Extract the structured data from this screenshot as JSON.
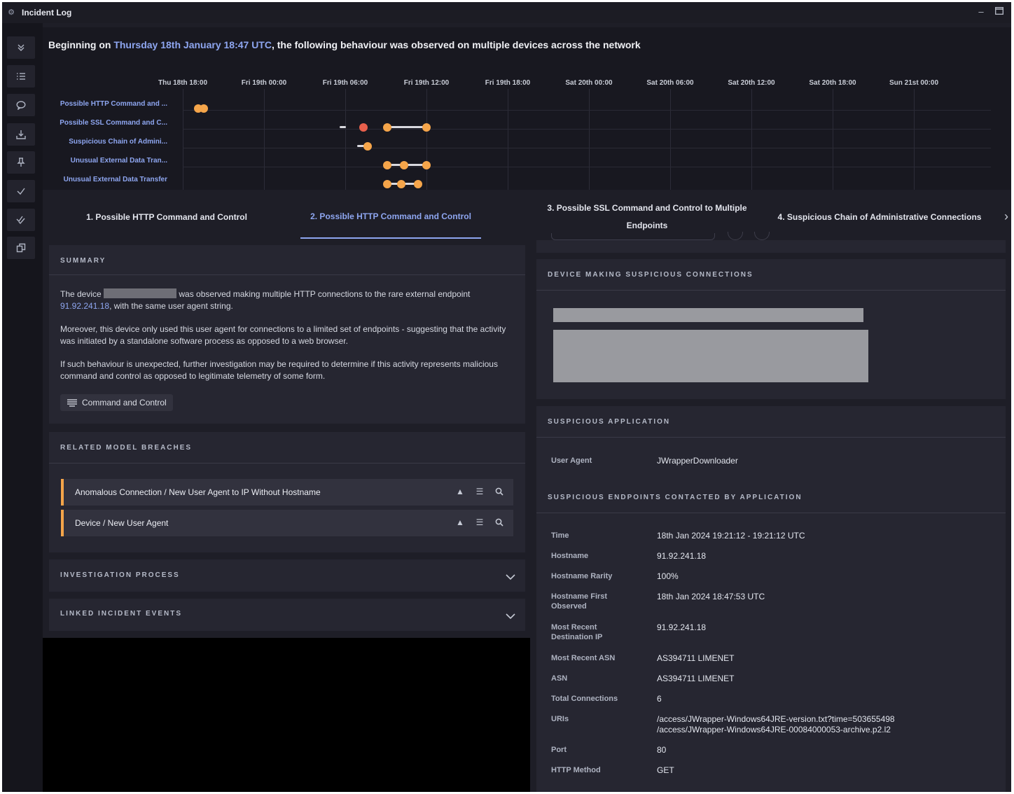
{
  "window": {
    "title": "Incident Log",
    "app_icon": "gear-cluster-icon",
    "minimize_icon": "minimize-icon",
    "maximize_icon": "maximize-icon"
  },
  "sidebar": {
    "items": [
      {
        "icon": "chevron-double-down-icon"
      },
      {
        "icon": "list-icon"
      },
      {
        "icon": "comment-icon"
      },
      {
        "icon": "download-icon"
      },
      {
        "icon": "pin-icon"
      },
      {
        "icon": "check-icon"
      },
      {
        "icon": "double-check-icon"
      },
      {
        "icon": "copy-icon"
      }
    ]
  },
  "headline": {
    "prefix": "Beginning on ",
    "date": "Thursday 18th January 18:47 UTC",
    "suffix": ", the following behaviour was observed on multiple devices across the network"
  },
  "timeline": {
    "ticks": [
      "Thu 18th 18:00",
      "Fri 19th 00:00",
      "Fri 19th 06:00",
      "Fri 19th 12:00",
      "Fri 19th 18:00",
      "Sat 20th 00:00",
      "Sat 20th 06:00",
      "Sat 20th 12:00",
      "Sat 20th 18:00",
      "Sun 21st 00:00"
    ],
    "rows": [
      "Possible HTTP Command and ...",
      "Possible SSL Command and C...",
      "Suspicious Chain of Admini...",
      "Unusual External Data Tran...",
      "Unusual External Data Transfer"
    ],
    "colors": {
      "event": "#f5a54a",
      "selected": "#e8604c",
      "bar": "#d9d9df"
    }
  },
  "tabs": [
    {
      "label": "1. Possible HTTP Command and Control",
      "active": false
    },
    {
      "label": "2. Possible HTTP Command and Control",
      "active": true
    },
    {
      "label_line1": "3. Possible SSL Command and Control to Multiple",
      "label_line2": "Endpoints",
      "active": false
    },
    {
      "label": "4. Suspicious Chain of Administrative Connections",
      "active": false
    }
  ],
  "tab_next_icon": "chevron-right-icon",
  "summary": {
    "header": "SUMMARY",
    "p1_a": "The device ",
    "p1_b": " was observed making multiple HTTP connections to the rare external endpoint",
    "p1_link": "91.92.241.18",
    "p1_c": ", with the same user agent string.",
    "p2": "Moreover, this device only used this user agent for connections to a limited set of endpoints - suggesting that the activity was initiated by a standalone software process as opposed to a web browser.",
    "p3": "If such behaviour is unexpected, further investigation may be required to determine if this activity represents malicious command and control as opposed to legitimate telemetry of some form.",
    "tag": "Command and Control"
  },
  "related": {
    "header": "RELATED MODEL BREACHES",
    "items": [
      {
        "label": "Anomalous Connection / New User Agent to IP Without Hostname"
      },
      {
        "label": "Device / New User Agent"
      }
    ]
  },
  "investigation": {
    "header": "INVESTIGATION PROCESS"
  },
  "linked": {
    "header": "LINKED INCIDENT EVENTS"
  },
  "device_panel": {
    "header": "DEVICE MAKING SUSPICIOUS CONNECTIONS"
  },
  "application": {
    "header": "SUSPICIOUS APPLICATION",
    "user_agent_key": "User Agent",
    "user_agent_val": "JWrapperDownloader"
  },
  "endpoints": {
    "header": "SUSPICIOUS ENDPOINTS CONTACTED BY APPLICATION",
    "rows": [
      {
        "key": "Time",
        "val": "18th Jan 2024 19:21:12 - 19:21:12 UTC"
      },
      {
        "key": "Hostname",
        "val": "91.92.241.18"
      },
      {
        "key": "Hostname Rarity",
        "val": "100%"
      },
      {
        "key": "Hostname First Observed",
        "val": "18th Jan 2024 18:47:53 UTC"
      },
      {
        "key": "Most Recent Destination IP",
        "val": "91.92.241.18"
      },
      {
        "key": "Most Recent ASN",
        "val": "AS394711 LIMENET"
      },
      {
        "key": "ASN",
        "val": "AS394711 LIMENET"
      },
      {
        "key": "Total Connections",
        "val": "6"
      },
      {
        "key": "URIs",
        "val": "/access/JWrapper-Windows64JRE-version.txt?time=503655498",
        "val2": "/access/JWrapper-Windows64JRE-00084000053-archive.p2.l2"
      },
      {
        "key": "Port",
        "val": "80"
      },
      {
        "key": "HTTP Method",
        "val": "GET"
      }
    ]
  }
}
